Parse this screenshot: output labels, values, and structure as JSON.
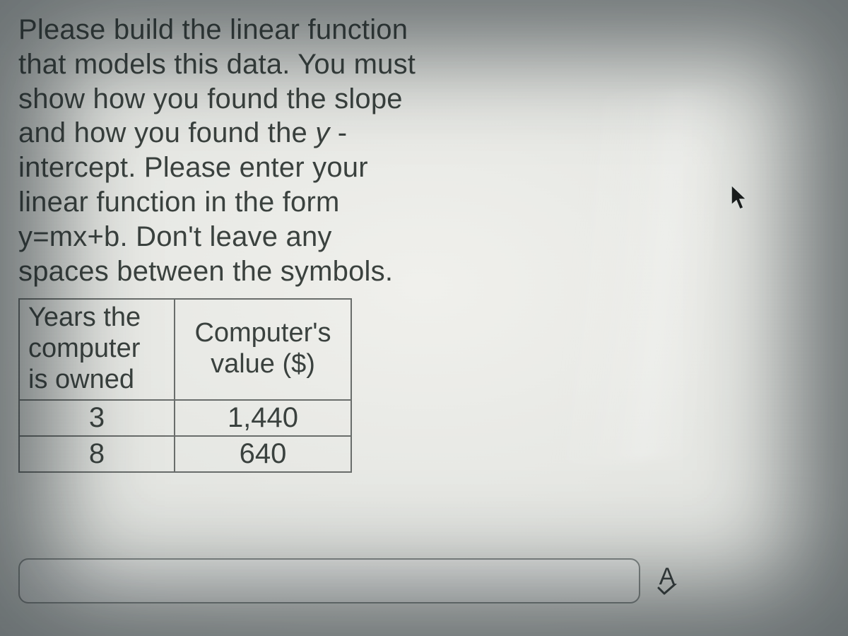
{
  "question": {
    "line1": "Please build the linear function",
    "line2": "that models this data.  You must",
    "line3": "show how you found the slope",
    "line4_a": "and how you found the ",
    "line4_y": "y",
    "line4_b": " -",
    "line5": "intercept.  Please enter your",
    "line6": "linear function in the form",
    "line7": "y=mx+b.  Don't leave any",
    "line8": "spaces between the symbols."
  },
  "table": {
    "headers": {
      "years": "Years the computer is owned",
      "value": "Computer's value ($)"
    },
    "rows": [
      {
        "years": "3",
        "value": "1,440"
      },
      {
        "years": "8",
        "value": "640"
      }
    ]
  },
  "answer": {
    "value": "",
    "placeholder": ""
  },
  "spellcheck_label": "A"
}
